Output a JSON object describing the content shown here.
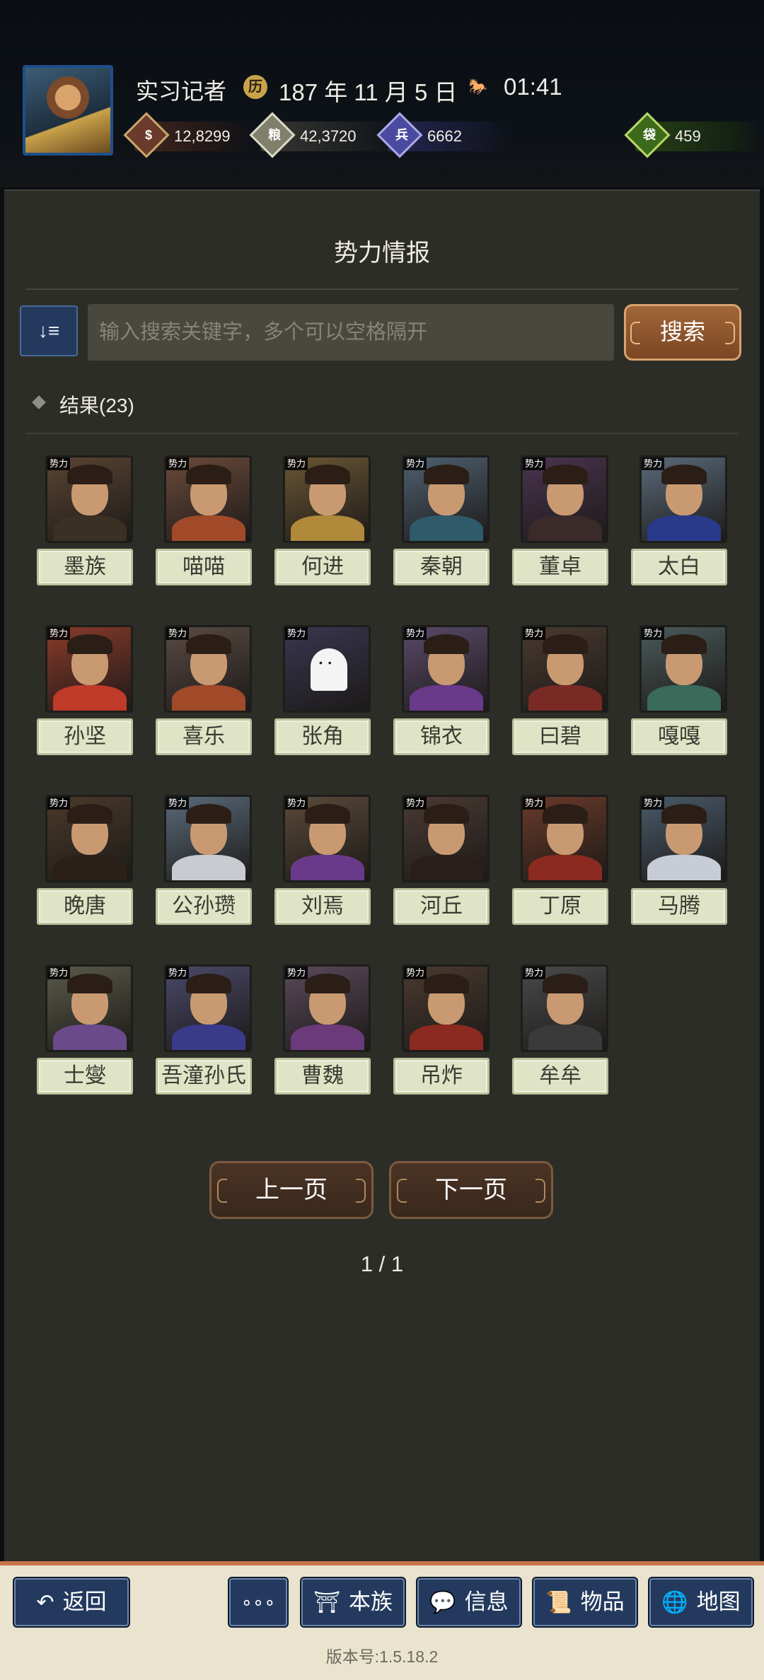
{
  "header": {
    "player_name": "实习记者",
    "date_icon": "calendar-seal-icon",
    "date": "187 年 11 月 5 日",
    "time_icon": "horse-icon",
    "time": "01:41",
    "resources": [
      {
        "icon": "coin-icon",
        "value": "12,8299"
      },
      {
        "icon": "grain-icon",
        "value": "42,3720"
      },
      {
        "icon": "soldier-icon",
        "value": "6662"
      },
      {
        "icon": "money-bag-icon",
        "value": "459"
      }
    ]
  },
  "panel": {
    "title": "势力情报",
    "sort_icon": "sort-icon",
    "search_placeholder": "输入搜索关键字，多个可以空格隔开",
    "search_value": "",
    "search_button": "搜索",
    "result_label": "结果(23)"
  },
  "factions": [
    {
      "tag": "势力",
      "name": "墨族",
      "bg": "#5a4432",
      "body": "#3a3024"
    },
    {
      "tag": "势力",
      "name": "喵喵",
      "bg": "#6b4a3a",
      "body": "#a04a2a"
    },
    {
      "tag": "势力",
      "name": "何进",
      "bg": "#6a5634",
      "body": "#b08a3a"
    },
    {
      "tag": "势力",
      "name": "秦朝",
      "bg": "#4f6070",
      "body": "#2f5a6a"
    },
    {
      "tag": "势力",
      "name": "董卓",
      "bg": "#4a3450",
      "body": "#3a2a2a"
    },
    {
      "tag": "势力",
      "name": "太白",
      "bg": "#5a6a7a",
      "body": "#2a3a8a"
    },
    {
      "tag": "势力",
      "name": "孙坚",
      "bg": "#8a3a2a",
      "body": "#c03a2a"
    },
    {
      "tag": "势力",
      "name": "喜乐",
      "bg": "#5a4a44",
      "body": "#a04a2a"
    },
    {
      "tag": "势力",
      "name": "张角",
      "bg": "#3a3650",
      "body": "#3a3650",
      "ghost": true
    },
    {
      "tag": "势力",
      "name": "锦衣",
      "bg": "#5a4a6a",
      "body": "#6a3a8a"
    },
    {
      "tag": "势力",
      "name": "曰碧",
      "bg": "#4a3a30",
      "body": "#7a2a24"
    },
    {
      "tag": "势力",
      "name": "嘎嘎",
      "bg": "#4a5a5a",
      "body": "#3a6a5a"
    },
    {
      "tag": "势力",
      "name": "晚唐",
      "bg": "#4a3a2a",
      "body": "#2a2018"
    },
    {
      "tag": "势力",
      "name": "公孙瓒",
      "bg": "#5a6a7a",
      "body": "#c8ccd0"
    },
    {
      "tag": "势力",
      "name": "刘焉",
      "bg": "#5a4a3a",
      "body": "#6a3a8a"
    },
    {
      "tag": "势力",
      "name": "河丘",
      "bg": "#4a3a34",
      "body": "#2a1e1a"
    },
    {
      "tag": "势力",
      "name": "丁原",
      "bg": "#6a3a2a",
      "body": "#8a2a20"
    },
    {
      "tag": "势力",
      "name": "马腾",
      "bg": "#4a5a6a",
      "body": "#c8ccd4"
    },
    {
      "tag": "势力",
      "name": "士燮",
      "bg": "#5a5a4a",
      "body": "#6a4a8a"
    },
    {
      "tag": "势力",
      "name": "吾潼孙氏",
      "bg": "#4a4a6a",
      "body": "#3a3a8a"
    },
    {
      "tag": "势力",
      "name": "曹魏",
      "bg": "#5a4a5a",
      "body": "#6a3a7a"
    },
    {
      "tag": "势力",
      "name": "吊炸",
      "bg": "#4a3a30",
      "body": "#8a2a20"
    },
    {
      "tag": "势力",
      "name": "牟牟",
      "bg": "#4a4a4a",
      "body": "#3a3a3a"
    }
  ],
  "pagination": {
    "prev": "上一页",
    "next": "下一页",
    "indicator": "1 / 1"
  },
  "bottom_nav": {
    "back": "返回",
    "more": "∘∘∘",
    "clan": "本族",
    "info": "信息",
    "items": "物品",
    "map": "地图",
    "version": "版本号:1.5.18.2"
  }
}
